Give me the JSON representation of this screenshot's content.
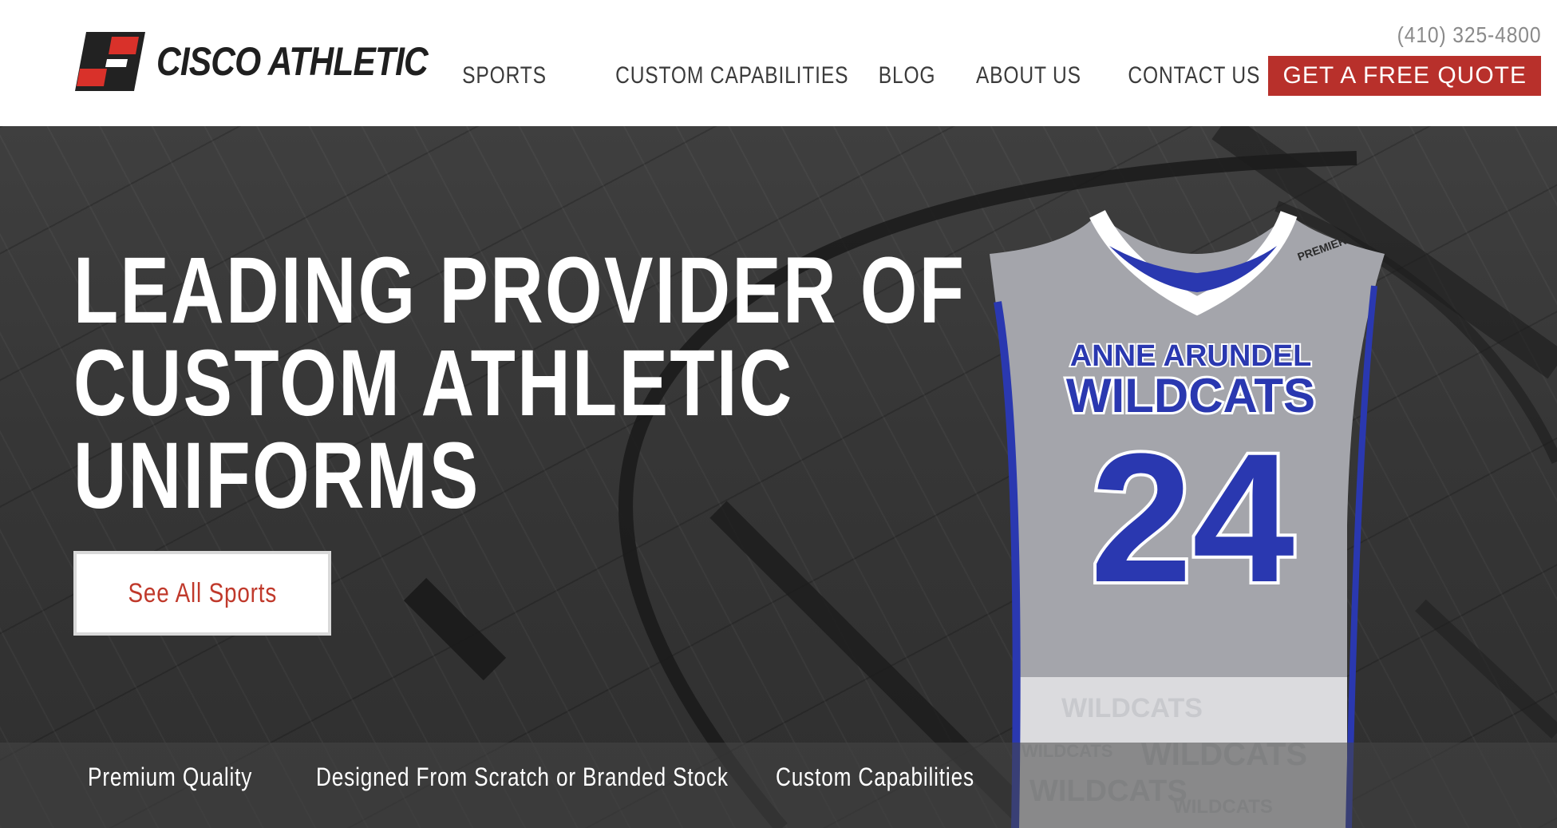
{
  "header": {
    "brand": "CISCO ATHLETIC",
    "phone": "(410) 325-4800",
    "nav": [
      "SPORTS",
      "CUSTOM CAPABILITIES",
      "BLOG",
      "ABOUT US",
      "CONTACT US"
    ],
    "quote_button": "GET A FREE QUOTE"
  },
  "hero": {
    "title_lines": [
      "LEADING PROVIDER OF",
      "CUSTOM ATHLETIC",
      "UNIFORMS"
    ],
    "cta_label": "See All Sports",
    "features": [
      "Premium Quality",
      "Designed From Scratch or Branded Stock",
      "Custom Capabilities"
    ],
    "jersey": {
      "team_line1": "ANNE ARUNDEL",
      "team_line2": "WILDCATS",
      "number": "24",
      "tag": "PREMIER",
      "pattern_word": "WILDCATS"
    }
  },
  "colors": {
    "brand_red": "#b8302b",
    "cta_text": "#c0392b",
    "nav_text": "#3b3b3b",
    "hero_bg": "#363636",
    "jersey_gray": "#a9aab0",
    "jersey_blue": "#2a38b0"
  }
}
